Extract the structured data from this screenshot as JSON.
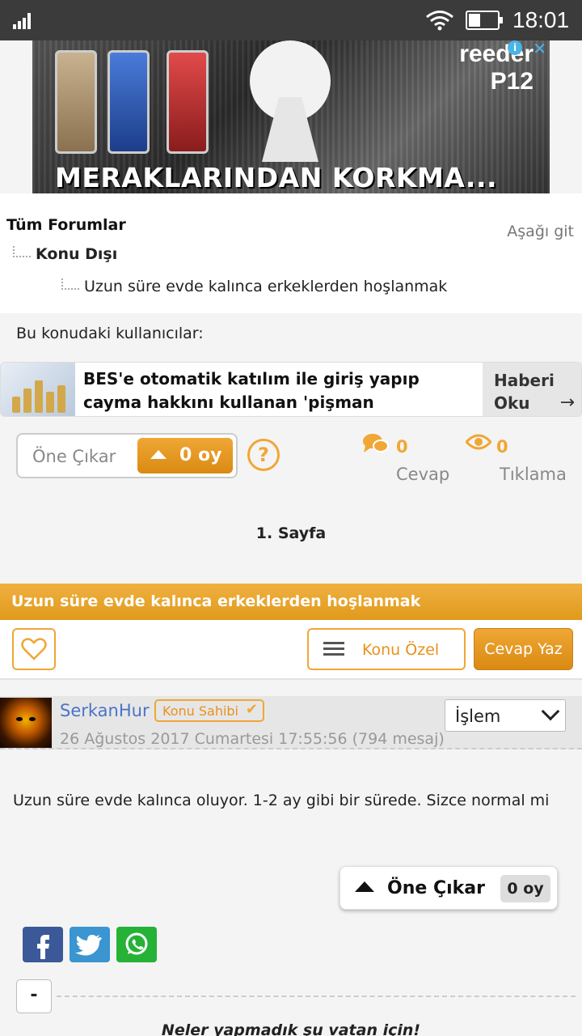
{
  "status_bar": {
    "time": "18:01"
  },
  "ad_banner": {
    "brand_line1": "reeder",
    "brand_line2": "P12",
    "headline": "MERAKLARINDAN KORKMA..."
  },
  "breadcrumb": {
    "root": "Tüm Forumlar",
    "scroll_down": "Aşağı git",
    "level1": "Konu Dışı",
    "level2": "Uzun süre evde kalınca erkeklerden hoşlanmak"
  },
  "users_label": "Bu konudaki kullanıcılar:",
  "native_ad": {
    "text": "BES'e otomatik katılım ile giriş yapıp cayma hakkını kullanan 'pişman katılımcı'nın",
    "cta_line1": "Haberi",
    "cta_line2": "Oku",
    "cta_arrow": "→"
  },
  "vote": {
    "label": "Öne Çıkar",
    "value": "0 oy"
  },
  "help": "?",
  "stats": {
    "replies": {
      "count": "0",
      "label": "Cevap"
    },
    "views": {
      "count": "0",
      "label": "Tıklama"
    }
  },
  "page_label": "1. Sayfa",
  "topic": {
    "title": "Uzun süre evde kalınca erkeklerden hoşlanmak",
    "konu_ozel": "Konu Özel",
    "reply": "Cevap Yaz"
  },
  "post": {
    "username": "SerkanHur",
    "badge": "Konu Sahibi",
    "badge_check": "✔",
    "date": "26 Ağustos 2017 Cumartesi 17:55:56 (794 mesaj)",
    "action_select": "İşlem",
    "body": "Uzun süre evde kalınca oluyor. 1-2 ay gibi bir sürede. Sizce normal mi",
    "promote_label": "Öne Çıkar",
    "promote_count": "0 oy",
    "collapse": "-",
    "signature": "Neler yapmadık şu vatan için!"
  },
  "share": {
    "facebook": "f",
    "twitter": "t",
    "whatsapp": "w"
  },
  "colors": {
    "accent": "#f0a735",
    "accent_dark": "#d98a12",
    "link": "#4a73c9",
    "facebook": "#3b5998",
    "twitter": "#3a95d0",
    "whatsapp": "#25b237"
  }
}
